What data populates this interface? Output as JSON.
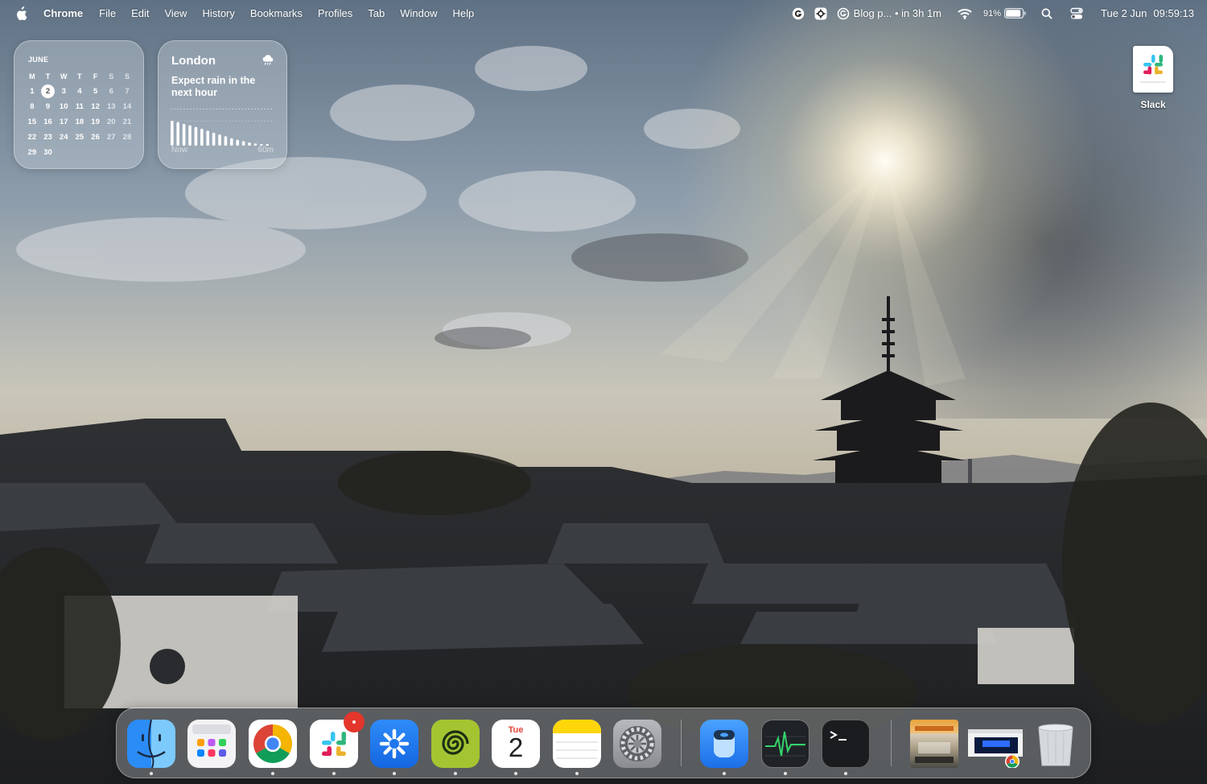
{
  "menubar": {
    "app_name": "Chrome",
    "menus": [
      "File",
      "Edit",
      "View",
      "History",
      "Bookmarks",
      "Profiles",
      "Tab",
      "Window",
      "Help"
    ],
    "status": {
      "reminder": "Blog p... • in 3h 1m",
      "battery_percent": "91%",
      "battery_level": 0.91,
      "date": "Tue 2 Jun",
      "time": "09:59:13"
    }
  },
  "calendar_widget": {
    "month": "JUNE",
    "weekdays": [
      "M",
      "T",
      "W",
      "T",
      "F",
      "S",
      "S"
    ],
    "weeks": [
      [
        "1",
        "2",
        "3",
        "4",
        "5",
        "6",
        "7"
      ],
      [
        "8",
        "9",
        "10",
        "11",
        "12",
        "13",
        "14"
      ],
      [
        "15",
        "16",
        "17",
        "18",
        "19",
        "20",
        "21"
      ],
      [
        "22",
        "23",
        "24",
        "25",
        "26",
        "27",
        "28"
      ],
      [
        "29",
        "30",
        "",
        "",
        "",
        "",
        ""
      ]
    ],
    "today": "2"
  },
  "weather_widget": {
    "city": "London",
    "description": "Expect rain in the next hour",
    "axis_start": "Now",
    "axis_end": "60m",
    "rain_intensity": [
      1.0,
      0.95,
      0.88,
      0.82,
      0.75,
      0.68,
      0.6,
      0.52,
      0.45,
      0.38,
      0.3,
      0.24,
      0.18,
      0.13,
      0.09,
      0.06,
      0.04
    ]
  },
  "desktop": {
    "items": [
      {
        "label": "Slack"
      }
    ]
  },
  "dock": {
    "apps": [
      {
        "name": "Finder",
        "running": true
      },
      {
        "name": "Launchpad",
        "running": false
      },
      {
        "name": "Google Chrome",
        "running": true
      },
      {
        "name": "Slack",
        "running": true,
        "badge": true
      },
      {
        "name": "Perplexity",
        "running": true
      },
      {
        "name": "Spiral",
        "running": true
      },
      {
        "name": "Calendar",
        "running": true,
        "day_label": "Tue",
        "day_number": "2"
      },
      {
        "name": "Notes",
        "running": true
      },
      {
        "name": "System Settings",
        "running": false
      },
      {
        "name": "Container",
        "running": true
      },
      {
        "name": "Activity Monitor",
        "running": true
      },
      {
        "name": "Terminal",
        "running": true
      },
      {
        "name": "Photo",
        "running": false
      },
      {
        "name": "Chrome Window",
        "running": false
      },
      {
        "name": "Trash",
        "running": false
      }
    ]
  },
  "colors": {
    "accent": "#0a7cff",
    "chrome_red": "#db4437",
    "chrome_yellow": "#f4b400",
    "chrome_green": "#0f9d58",
    "chrome_blue": "#4285f4"
  }
}
